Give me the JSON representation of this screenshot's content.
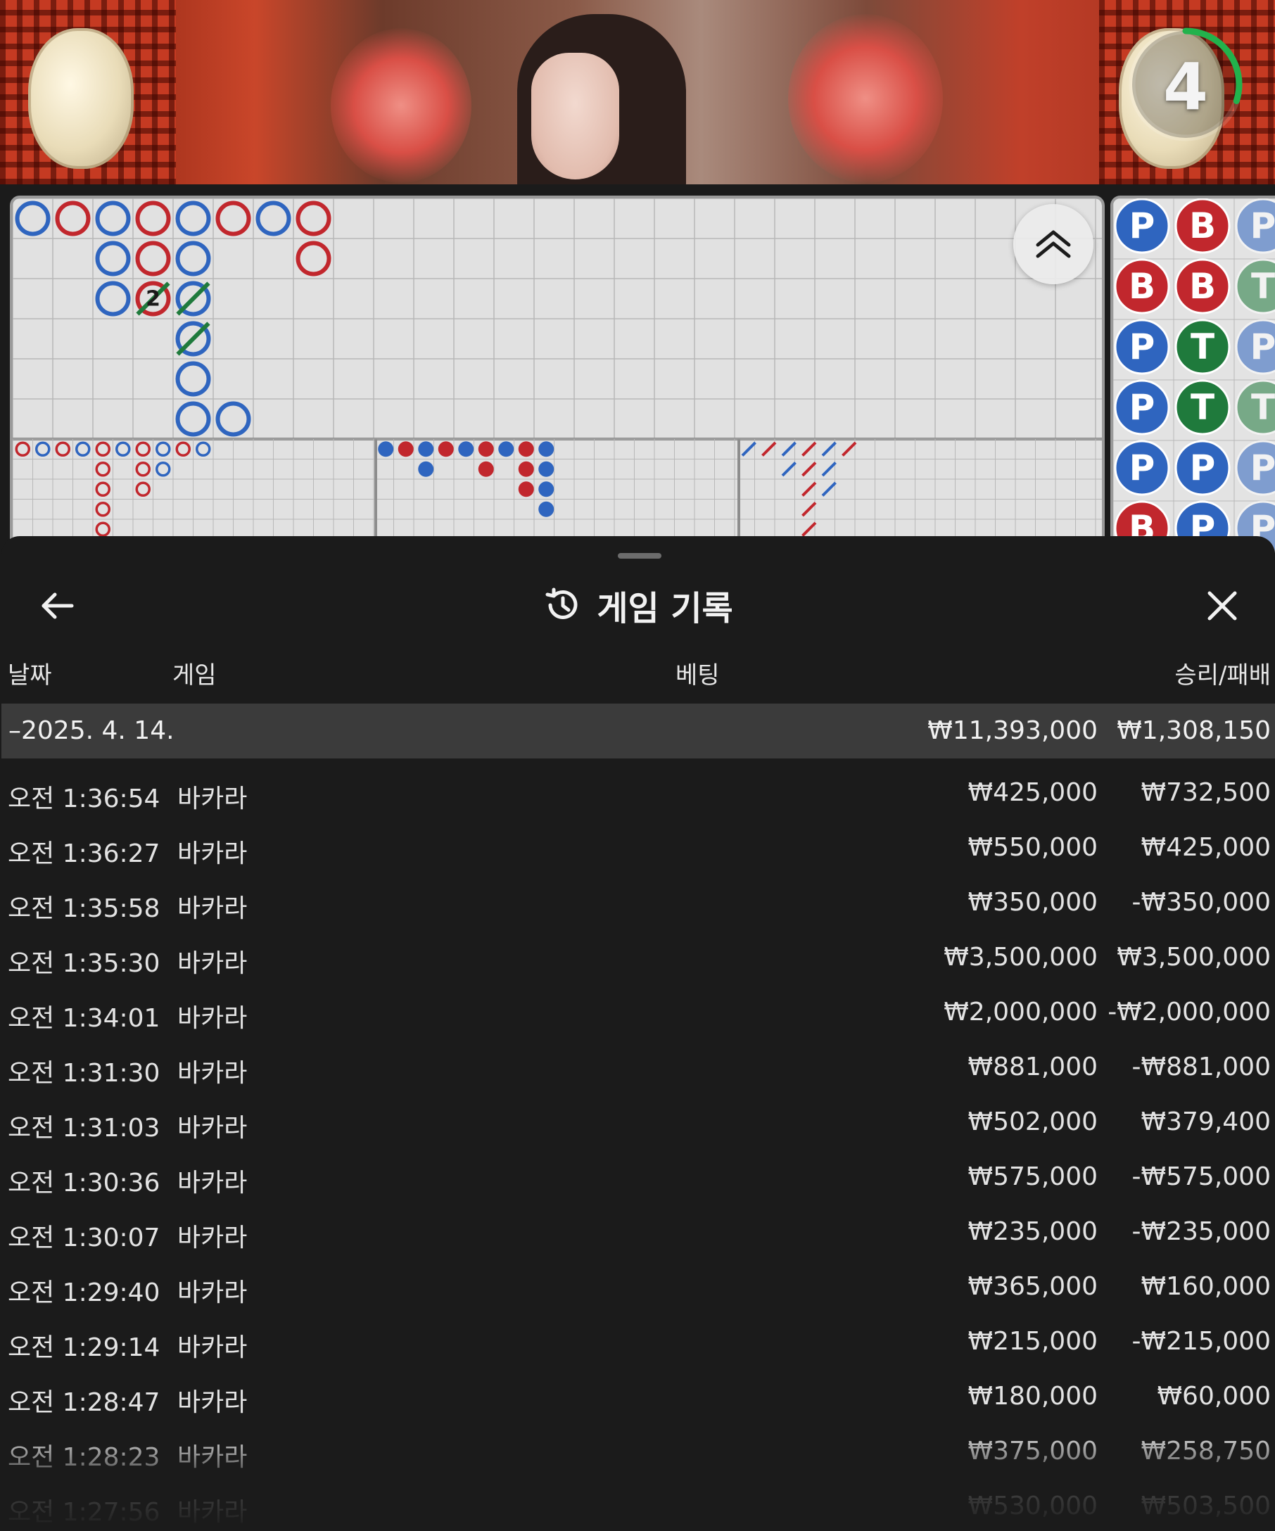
{
  "video": {
    "countdown": "4",
    "countdown_fraction": 0.3
  },
  "scoreboard": {
    "colors": {
      "player": "#2f65bf",
      "banker": "#c1272d",
      "tie": "#1f7a3c",
      "grid": "#b8b8b8",
      "bg": "#e1e1e1"
    },
    "tie_count_label": "2",
    "collapse_icon": "double-chevron-up-icon",
    "big_road": [
      {
        "col": 0,
        "row": 0,
        "s": "P"
      },
      {
        "col": 1,
        "row": 0,
        "s": "B"
      },
      {
        "col": 2,
        "row": 0,
        "s": "P"
      },
      {
        "col": 3,
        "row": 0,
        "s": "B"
      },
      {
        "col": 4,
        "row": 0,
        "s": "P"
      },
      {
        "col": 5,
        "row": 0,
        "s": "B"
      },
      {
        "col": 6,
        "row": 0,
        "s": "P"
      },
      {
        "col": 7,
        "row": 0,
        "s": "B"
      },
      {
        "col": 2,
        "row": 1,
        "s": "P"
      },
      {
        "col": 3,
        "row": 1,
        "s": "B"
      },
      {
        "col": 4,
        "row": 1,
        "s": "P"
      },
      {
        "col": 7,
        "row": 1,
        "s": "B"
      },
      {
        "col": 2,
        "row": 2,
        "s": "P"
      },
      {
        "col": 3,
        "row": 2,
        "s": "B",
        "tie": true,
        "label": true
      },
      {
        "col": 4,
        "row": 2,
        "s": "P",
        "tie": true
      },
      {
        "col": 4,
        "row": 3,
        "s": "P",
        "tie": true
      },
      {
        "col": 4,
        "row": 4,
        "s": "P"
      },
      {
        "col": 4,
        "row": 5,
        "s": "P"
      },
      {
        "col": 5,
        "row": 5,
        "s": "P"
      }
    ],
    "big_eye_road": [
      {
        "col": 0,
        "row": 0,
        "s": "B"
      },
      {
        "col": 1,
        "row": 0,
        "s": "P"
      },
      {
        "col": 2,
        "row": 0,
        "s": "B"
      },
      {
        "col": 3,
        "row": 0,
        "s": "P"
      },
      {
        "col": 4,
        "row": 0,
        "s": "B"
      },
      {
        "col": 5,
        "row": 0,
        "s": "P"
      },
      {
        "col": 6,
        "row": 0,
        "s": "B"
      },
      {
        "col": 7,
        "row": 0,
        "s": "P"
      },
      {
        "col": 8,
        "row": 0,
        "s": "B"
      },
      {
        "col": 9,
        "row": 0,
        "s": "P"
      },
      {
        "col": 4,
        "row": 1,
        "s": "B"
      },
      {
        "col": 6,
        "row": 1,
        "s": "B"
      },
      {
        "col": 7,
        "row": 1,
        "s": "P"
      },
      {
        "col": 4,
        "row": 2,
        "s": "B"
      },
      {
        "col": 6,
        "row": 2,
        "s": "B"
      },
      {
        "col": 4,
        "row": 3,
        "s": "B"
      },
      {
        "col": 4,
        "row": 4,
        "s": "B"
      }
    ],
    "small_road": [
      {
        "col": 0,
        "row": 0,
        "s": "P"
      },
      {
        "col": 1,
        "row": 0,
        "s": "B"
      },
      {
        "col": 2,
        "row": 0,
        "s": "P"
      },
      {
        "col": 3,
        "row": 0,
        "s": "B"
      },
      {
        "col": 4,
        "row": 0,
        "s": "P"
      },
      {
        "col": 5,
        "row": 0,
        "s": "B"
      },
      {
        "col": 6,
        "row": 0,
        "s": "P"
      },
      {
        "col": 7,
        "row": 0,
        "s": "B"
      },
      {
        "col": 8,
        "row": 0,
        "s": "P"
      },
      {
        "col": 2,
        "row": 1,
        "s": "P"
      },
      {
        "col": 5,
        "row": 1,
        "s": "B"
      },
      {
        "col": 7,
        "row": 1,
        "s": "B"
      },
      {
        "col": 8,
        "row": 1,
        "s": "P"
      },
      {
        "col": 7,
        "row": 2,
        "s": "B"
      },
      {
        "col": 8,
        "row": 2,
        "s": "P"
      },
      {
        "col": 8,
        "row": 3,
        "s": "P"
      }
    ],
    "cockroach_road": [
      {
        "col": 0,
        "row": 0,
        "s": "P"
      },
      {
        "col": 1,
        "row": 0,
        "s": "B"
      },
      {
        "col": 2,
        "row": 0,
        "s": "P"
      },
      {
        "col": 3,
        "row": 0,
        "s": "B"
      },
      {
        "col": 4,
        "row": 0,
        "s": "P"
      },
      {
        "col": 5,
        "row": 0,
        "s": "B"
      },
      {
        "col": 2,
        "row": 1,
        "s": "P"
      },
      {
        "col": 3,
        "row": 1,
        "s": "B"
      },
      {
        "col": 4,
        "row": 1,
        "s": "P"
      },
      {
        "col": 3,
        "row": 2,
        "s": "B"
      },
      {
        "col": 4,
        "row": 2,
        "s": "P"
      },
      {
        "col": 3,
        "row": 3,
        "s": "B"
      },
      {
        "col": 3,
        "row": 4,
        "s": "B"
      }
    ],
    "bead_plate": [
      [
        "P",
        "B",
        "P"
      ],
      [
        "B",
        "B",
        "T"
      ],
      [
        "P",
        "T",
        "P"
      ],
      [
        "P",
        "T",
        "T"
      ],
      [
        "P",
        "P",
        "P"
      ],
      [
        "B",
        "P",
        "P"
      ]
    ]
  },
  "sheet": {
    "title": "게임 기록",
    "history_icon": "history-icon",
    "back_icon": "arrow-left-icon",
    "close_icon": "close-icon",
    "headers": {
      "date": "날짜",
      "game": "게임",
      "bet": "베팅",
      "winloss": "승리/패배"
    },
    "summary": {
      "date": "–2025. 4. 14.",
      "bet": "₩11,393,000",
      "winloss": "₩1,308,150"
    },
    "rows": [
      {
        "time": "오전 1:36:54",
        "game": "바카라",
        "bet": "₩425,000",
        "winloss": "₩732,500"
      },
      {
        "time": "오전 1:36:27",
        "game": "바카라",
        "bet": "₩550,000",
        "winloss": "₩425,000"
      },
      {
        "time": "오전 1:35:58",
        "game": "바카라",
        "bet": "₩350,000",
        "winloss": "-₩350,000"
      },
      {
        "time": "오전 1:35:30",
        "game": "바카라",
        "bet": "₩3,500,000",
        "winloss": "₩3,500,000"
      },
      {
        "time": "오전 1:34:01",
        "game": "바카라",
        "bet": "₩2,000,000",
        "winloss": "-₩2,000,000"
      },
      {
        "time": "오전 1:31:30",
        "game": "바카라",
        "bet": "₩881,000",
        "winloss": "-₩881,000"
      },
      {
        "time": "오전 1:31:03",
        "game": "바카라",
        "bet": "₩502,000",
        "winloss": "₩379,400"
      },
      {
        "time": "오전 1:30:36",
        "game": "바카라",
        "bet": "₩575,000",
        "winloss": "-₩575,000"
      },
      {
        "time": "오전 1:30:07",
        "game": "바카라",
        "bet": "₩235,000",
        "winloss": "-₩235,000"
      },
      {
        "time": "오전 1:29:40",
        "game": "바카라",
        "bet": "₩365,000",
        "winloss": "₩160,000"
      },
      {
        "time": "오전 1:29:14",
        "game": "바카라",
        "bet": "₩215,000",
        "winloss": "-₩215,000"
      },
      {
        "time": "오전 1:28:47",
        "game": "바카라",
        "bet": "₩180,000",
        "winloss": "₩60,000"
      },
      {
        "time": "오전 1:28:23",
        "game": "바카라",
        "bet": "₩375,000",
        "winloss": "₩258,750"
      },
      {
        "time": "오전 1:27:56",
        "game": "바카라",
        "bet": "₩530,000",
        "winloss": "₩503,500"
      }
    ]
  }
}
